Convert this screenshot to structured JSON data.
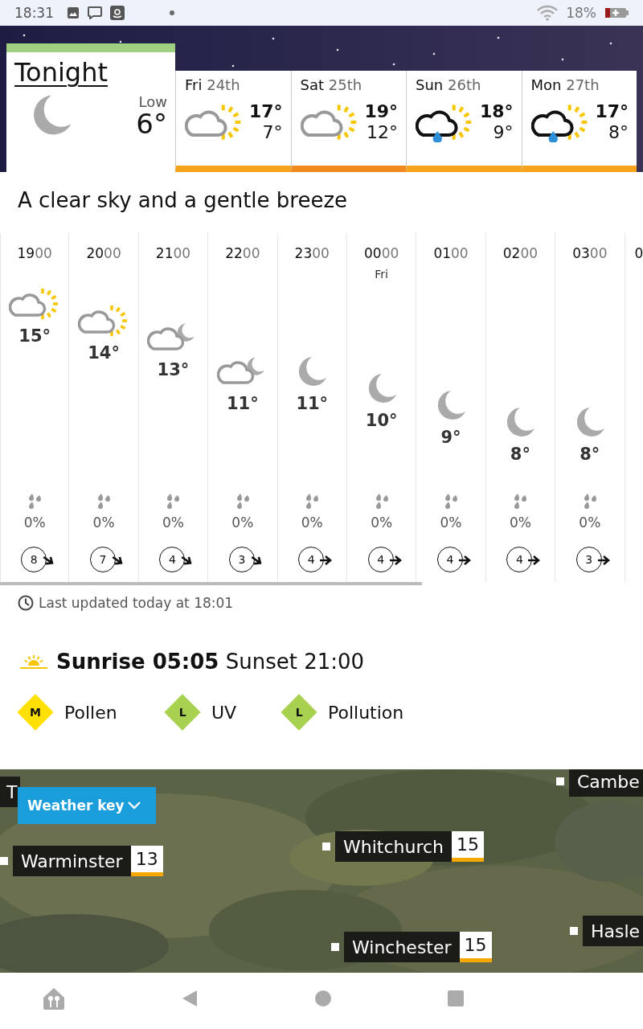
{
  "status_bar": {
    "time": "18:31",
    "battery": "18%"
  },
  "tonight": {
    "title": "Tonight",
    "kind": "clear-night",
    "low_label": "Low",
    "low": "6°"
  },
  "days": [
    {
      "day": "**Fri** 24th",
      "kind": "sunny-intervals",
      "high": "17°",
      "low": "7°",
      "color": "#f7a21b"
    },
    {
      "day": "**Sat** 25th",
      "kind": "sunny-intervals",
      "high": "19°",
      "low": "12°",
      "color": "#f0891e"
    },
    {
      "day": "**Sun** 26th",
      "kind": "light-rain-sun",
      "high": "18°",
      "low": "9°",
      "color": "#f7a21b"
    },
    {
      "day": "**Mon** 27th",
      "kind": "light-rain-sun",
      "high": "17°",
      "low": "8°",
      "color": "#f7a21b"
    }
  ],
  "summary": "A clear sky and a gentle breeze",
  "hours": [
    {
      "time": "**19**00",
      "kind": "sunny-intervals",
      "temp": "15°",
      "rain": "0%",
      "wind": {
        "speed": "8",
        "kind": "diagonal"
      }
    },
    {
      "time": "**20**00",
      "kind": "sunny-intervals",
      "temp": "14°",
      "rain": "0%",
      "wind": {
        "speed": "7",
        "kind": "diagonal"
      }
    },
    {
      "time": "**21**00",
      "kind": "partly-cloudy-night",
      "temp": "13°",
      "rain": "0%",
      "wind": {
        "speed": "4",
        "kind": "diagonal"
      }
    },
    {
      "time": "**22**00",
      "kind": "partly-cloudy-night",
      "temp": "11°",
      "rain": "0%",
      "wind": {
        "speed": "3",
        "kind": "diagonal"
      }
    },
    {
      "time": "**23**00",
      "kind": "clear-night",
      "temp": "11°",
      "rain": "0%",
      "wind": {
        "speed": "4",
        "kind": "straight"
      }
    },
    {
      "time": "**00**00",
      "day": "Fri",
      "kind": "clear-night",
      "temp": "10°",
      "rain": "0%",
      "wind": {
        "speed": "4",
        "kind": "straight"
      }
    },
    {
      "time": "**01**00",
      "kind": "clear-night",
      "temp": "9°",
      "rain": "0%",
      "wind": {
        "speed": "4",
        "kind": "straight"
      }
    },
    {
      "time": "**02**00",
      "kind": "clear-night",
      "temp": "8°",
      "rain": "0%",
      "wind": {
        "speed": "4",
        "kind": "straight"
      }
    },
    {
      "time": "**03**00",
      "kind": "clear-night",
      "temp": "8°",
      "rain": "0%",
      "wind": {
        "speed": "3",
        "kind": "straight"
      }
    },
    {
      "time": "**0**"
    }
  ],
  "last_updated": "Last updated today at 18:01",
  "sun_times": "**Sunrise 05:05** Sunset 21:00",
  "indices": [
    {
      "letter": "M",
      "label": "Pollen",
      "color": "#ffe000"
    },
    {
      "letter": "L",
      "label": "UV",
      "color": "#a8d14f"
    },
    {
      "letter": "L",
      "label": "Pollution",
      "color": "#a8d14f"
    }
  ],
  "map": {
    "button": "Weather key",
    "labels": [
      {
        "name": "T"
      },
      {
        "name": "Cambe"
      },
      {
        "name": "Whitchurch",
        "temp": "15"
      },
      {
        "name": "Warminster",
        "temp": "13"
      },
      {
        "name": "Winchester",
        "temp": "15"
      },
      {
        "name": "Hasle"
      }
    ]
  }
}
